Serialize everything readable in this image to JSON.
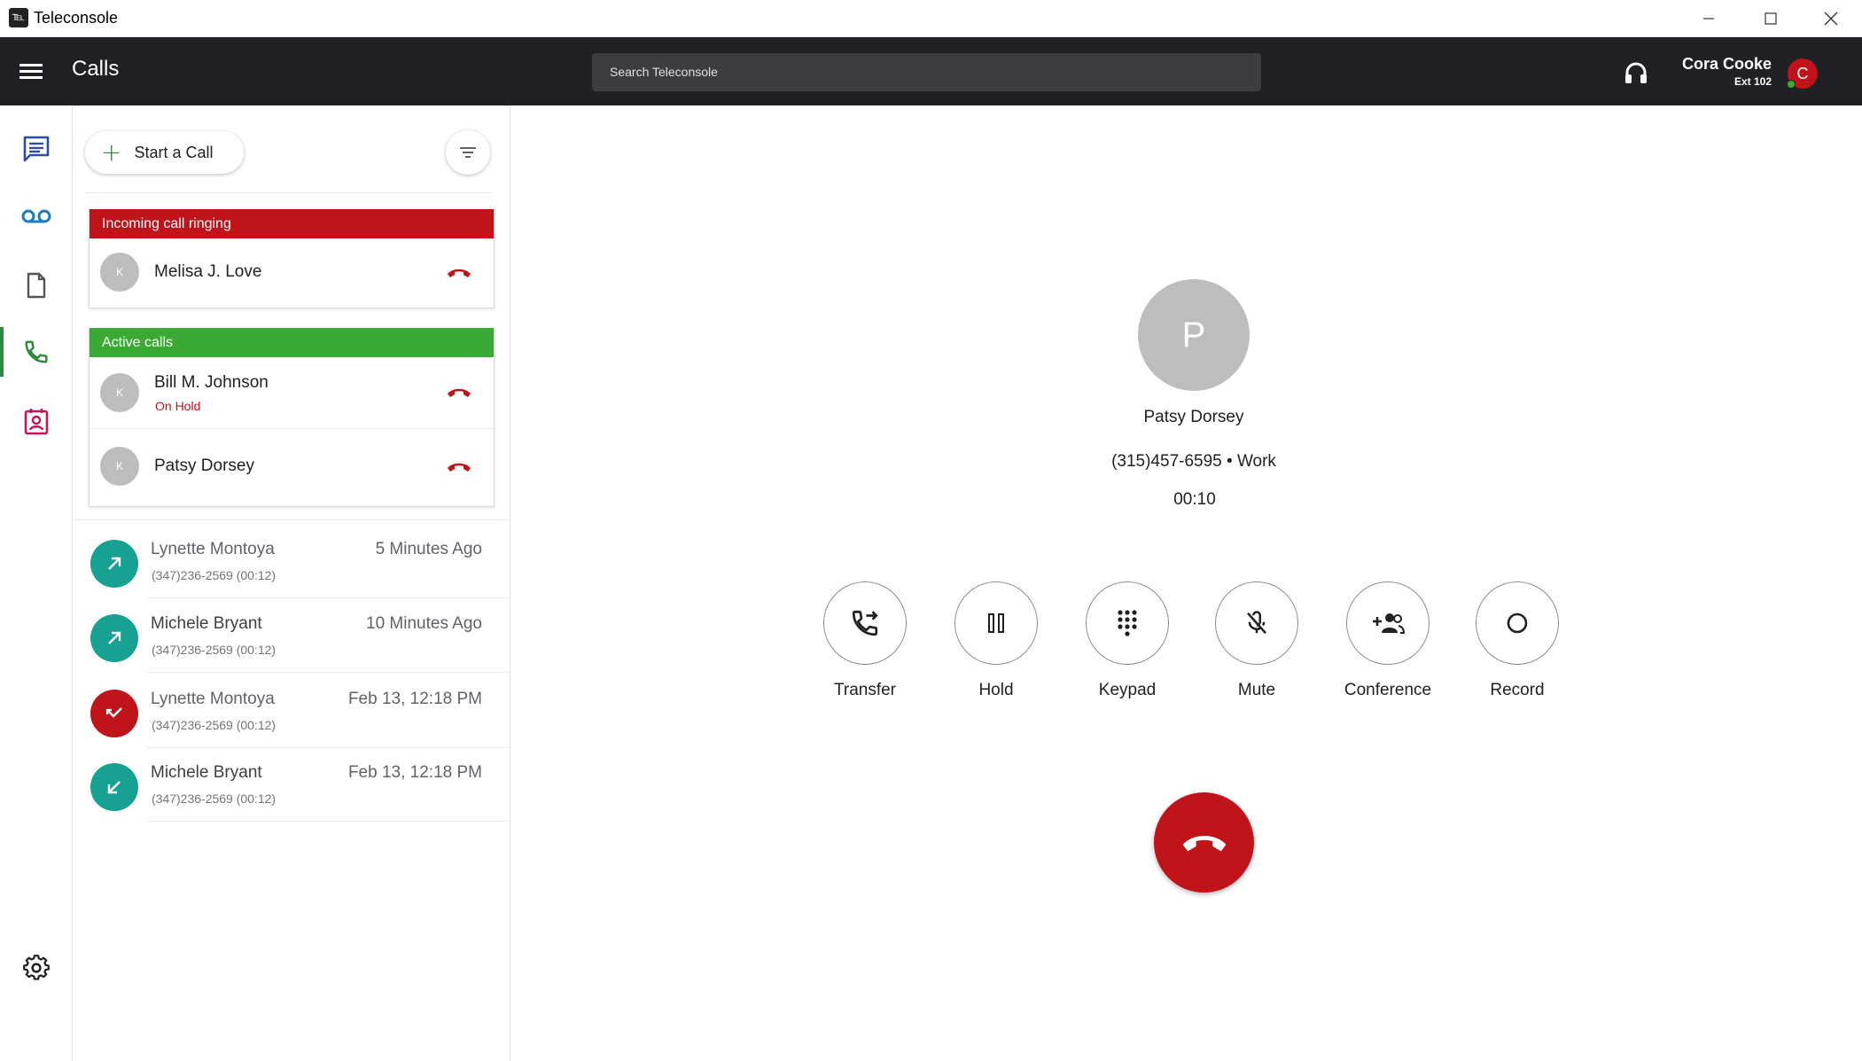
{
  "window": {
    "title": "Teleconsole",
    "logo_glyph": "℡",
    "controls": [
      "minimize-icon",
      "maximize-icon",
      "close-icon"
    ]
  },
  "header": {
    "title": "Calls",
    "search_placeholder": "Search Teleconsole",
    "user": {
      "name": "Cora Cooke",
      "ext": "Ext 102",
      "avatar_initial": "C",
      "presence": "online"
    }
  },
  "rail": {
    "items": [
      {
        "icon": "message-icon",
        "active": false
      },
      {
        "icon": "voicemail-icon",
        "active": false
      },
      {
        "icon": "document-icon",
        "active": false
      },
      {
        "icon": "phone-icon",
        "active": true
      },
      {
        "icon": "contacts-icon",
        "active": false
      },
      {
        "icon": "settings-icon",
        "active": false
      }
    ]
  },
  "calls_panel": {
    "start_call_label": "Start a Call",
    "incoming": {
      "header": "Incoming call ringing",
      "calls": [
        {
          "initial": "K",
          "name": "Melisa J. Love",
          "status": ""
        }
      ]
    },
    "active": {
      "header": "Active calls",
      "calls": [
        {
          "initial": "K",
          "name": "Bill M. Johnson",
          "status": "On Hold"
        },
        {
          "initial": "K",
          "name": "Patsy Dorsey",
          "status": ""
        }
      ]
    },
    "recent": [
      {
        "name": "Lynette Montoya",
        "detail": "(347)236-2569 (00:12)",
        "time": "5 Minutes Ago",
        "direction": "outgoing"
      },
      {
        "name": "Michele Bryant",
        "detail": "(347)236-2569 (00:12)",
        "time": "10 Minutes Ago",
        "direction": "outgoing"
      },
      {
        "name": "Lynette Montoya",
        "detail": "(347)236-2569 (00:12)",
        "time": "Feb 13, 12:18 PM",
        "direction": "missed"
      },
      {
        "name": "Michele Bryant",
        "detail": "(347)236-2569 (00:12)",
        "time": "Feb 13, 12:18 PM",
        "direction": "incoming"
      }
    ]
  },
  "current_call": {
    "avatar_initial": "P",
    "name": "Patsy Dorsey",
    "number": "(315)457-6595 • Work",
    "duration": "00:10",
    "actions": [
      {
        "label": "Transfer",
        "icon": "transfer-icon"
      },
      {
        "label": "Hold",
        "icon": "pause-icon"
      },
      {
        "label": "Keypad",
        "icon": "dialpad-icon"
      },
      {
        "label": "Mute",
        "icon": "mic-off-icon"
      },
      {
        "label": "Conference",
        "icon": "add-group-icon"
      },
      {
        "label": "Record",
        "icon": "record-icon"
      }
    ]
  },
  "colors": {
    "header_bg": "#202124",
    "incoming_header": "#c0141a",
    "active_header": "#3aaa35",
    "accent_green": "#2e8b3e",
    "teal": "#17a192",
    "danger": "#c0141a",
    "voicemail": "#1d7bbf",
    "contacts": "#c2185b",
    "message": "#2b4fa6"
  }
}
